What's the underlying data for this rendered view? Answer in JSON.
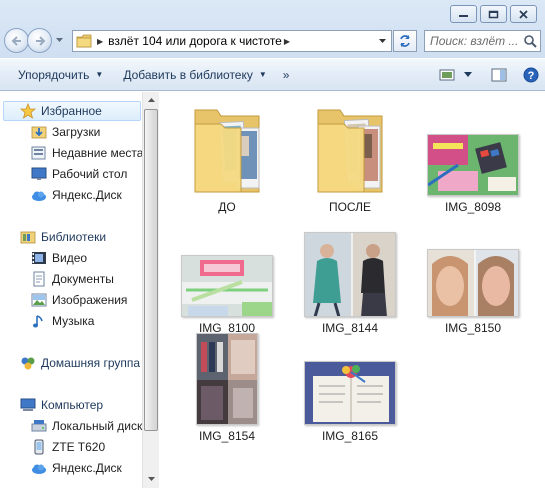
{
  "window": {
    "buttons": [
      {
        "name": "minimize-button",
        "icon": "minimize-icon"
      },
      {
        "name": "maximize-button",
        "icon": "maximize-icon"
      },
      {
        "name": "close-button",
        "icon": "close-icon"
      }
    ]
  },
  "address_bar": {
    "path": "взлёт 104 или дорога к чистоте",
    "search_placeholder": "Поиск: взлёт ..."
  },
  "toolbar": {
    "organize_label": "Упорядочить",
    "add_to_library_label": "Добавить в библиотеку",
    "more_label": "»"
  },
  "sidebar": {
    "items": [
      {
        "label": "Избранное",
        "icon": "star-icon",
        "head": true
      },
      {
        "label": "Загрузки",
        "icon": "downloads-folder-icon"
      },
      {
        "label": "Недавние места",
        "icon": "recent-places-icon"
      },
      {
        "label": "Рабочий стол",
        "icon": "desktop-icon"
      },
      {
        "label": "Яндекс.Диск",
        "icon": "cloud-disk-icon"
      },
      {
        "label": "Библиотеки",
        "icon": "libraries-icon",
        "head": true
      },
      {
        "label": "Видео",
        "icon": "video-icon"
      },
      {
        "label": "Документы",
        "icon": "documents-icon"
      },
      {
        "label": "Изображения",
        "icon": "pictures-icon"
      },
      {
        "label": "Музыка",
        "icon": "music-icon"
      },
      {
        "label": "Домашняя группа",
        "icon": "homegroup-icon",
        "head": true
      },
      {
        "label": "Компьютер",
        "icon": "computer-icon",
        "head": true
      },
      {
        "label": "Локальный диск",
        "icon": "local-disk-icon"
      },
      {
        "label": "ZTE T620",
        "icon": "phone-icon"
      },
      {
        "label": "Яндекс.Диск",
        "icon": "cloud-disk-icon"
      }
    ]
  },
  "files": [
    {
      "name": "ДО",
      "type": "folder"
    },
    {
      "name": "ПОСЛЕ",
      "type": "folder"
    },
    {
      "name": "IMG_8098",
      "type": "image"
    },
    {
      "name": "IMG_8100",
      "type": "image"
    },
    {
      "name": "IMG_8144",
      "type": "image"
    },
    {
      "name": "IMG_8150",
      "type": "image"
    },
    {
      "name": "IMG_8154",
      "type": "image"
    },
    {
      "name": "IMG_8165",
      "type": "image"
    }
  ],
  "colors": {
    "chrome": "#d7e5f4",
    "accent": "#1e395b",
    "selection": "#dceefc"
  }
}
